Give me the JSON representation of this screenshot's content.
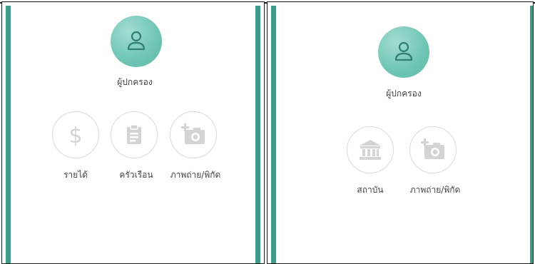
{
  "left_panel": {
    "profile_label": "ผู้ปกครอง",
    "options": [
      {
        "icon": "dollar-icon",
        "label": "รายได้"
      },
      {
        "icon": "clipboard-icon",
        "label": "ครัวเรือน"
      },
      {
        "icon": "add-photo-icon",
        "label": "ภาพถ่าย/พิกัด"
      }
    ]
  },
  "right_panel": {
    "profile_label": "ผู้ปกครอง",
    "options": [
      {
        "icon": "bank-icon",
        "label": "สถาบัน"
      },
      {
        "icon": "add-photo-icon",
        "label": "ภาพถ่าย/พิกัด"
      }
    ]
  },
  "colors": {
    "accent": "#5cb9a6",
    "side_bar": "#3f9a8a",
    "icon_gray": "#d4d4d4"
  }
}
